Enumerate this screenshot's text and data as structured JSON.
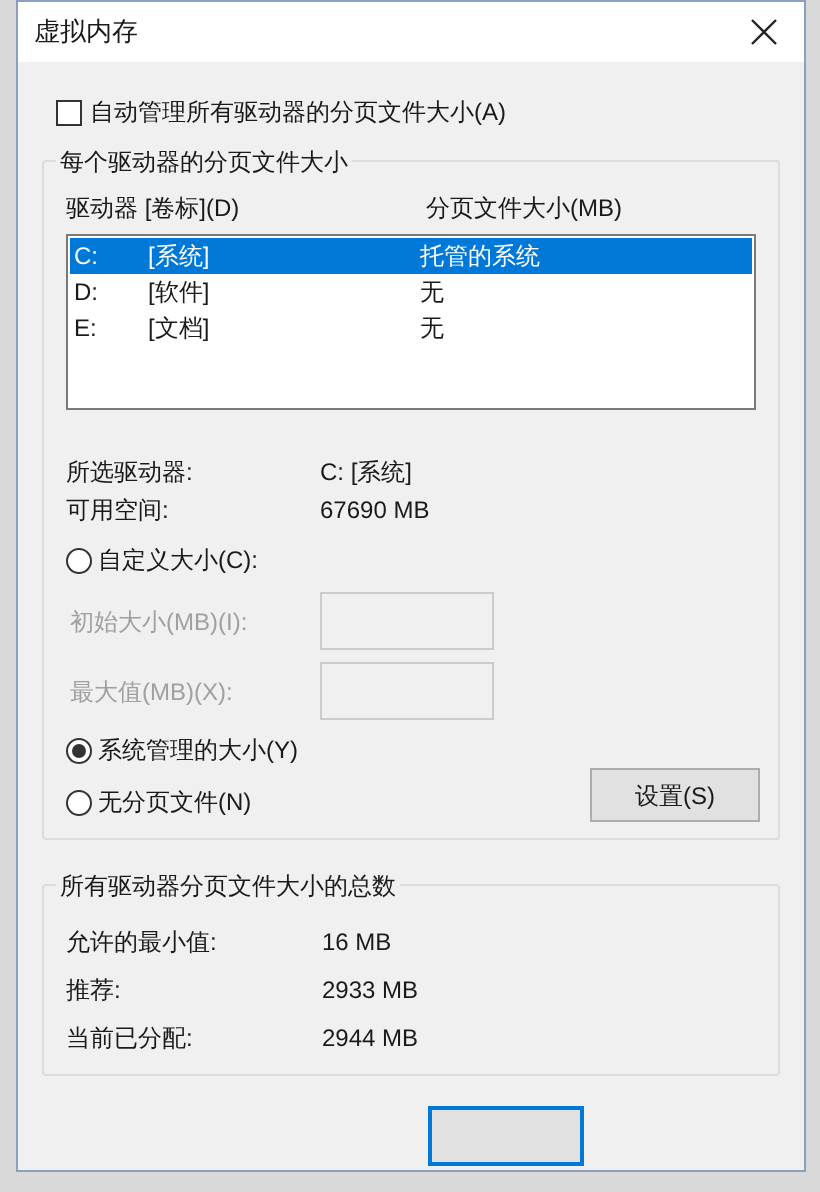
{
  "window": {
    "title": "虚拟内存"
  },
  "auto_manage": {
    "label": "自动管理所有驱动器的分页文件大小(A)",
    "checked": false
  },
  "per_drive": {
    "title": "每个驱动器的分页文件大小",
    "columns": [
      "驱动器 [卷标](D)",
      "分页文件大小(MB)"
    ],
    "drives": [
      {
        "drive": "C:",
        "label": "[系统]",
        "size": "托管的系统",
        "selected": true
      },
      {
        "drive": "D:",
        "label": "[软件]",
        "size": "无",
        "selected": false
      },
      {
        "drive": "E:",
        "label": "[文档]",
        "size": "无",
        "selected": false
      }
    ],
    "info": [
      {
        "label": "所选驱动器:",
        "value": "C:  [系统]"
      },
      {
        "label": "可用空间:",
        "value": "67690 MB"
      }
    ],
    "options": [
      {
        "label": "自定义大小(C):",
        "selected": false
      },
      {
        "label": "系统管理的大小(Y)",
        "selected": true
      },
      {
        "label": "无分页文件(N)",
        "selected": false
      }
    ],
    "fields": [
      {
        "label": "初始大小(MB)(I):",
        "disabled": true
      },
      {
        "label": "最大值(MB)(X):",
        "disabled": true
      }
    ],
    "set_button": "设置(S)"
  },
  "totals": {
    "title": "所有驱动器分页文件大小的总数",
    "rows": [
      {
        "label": "允许的最小值:",
        "value": "16 MB"
      },
      {
        "label": "推荐:",
        "value": "2933 MB"
      },
      {
        "label": "当前已分配:",
        "value": "2944 MB"
      }
    ]
  }
}
